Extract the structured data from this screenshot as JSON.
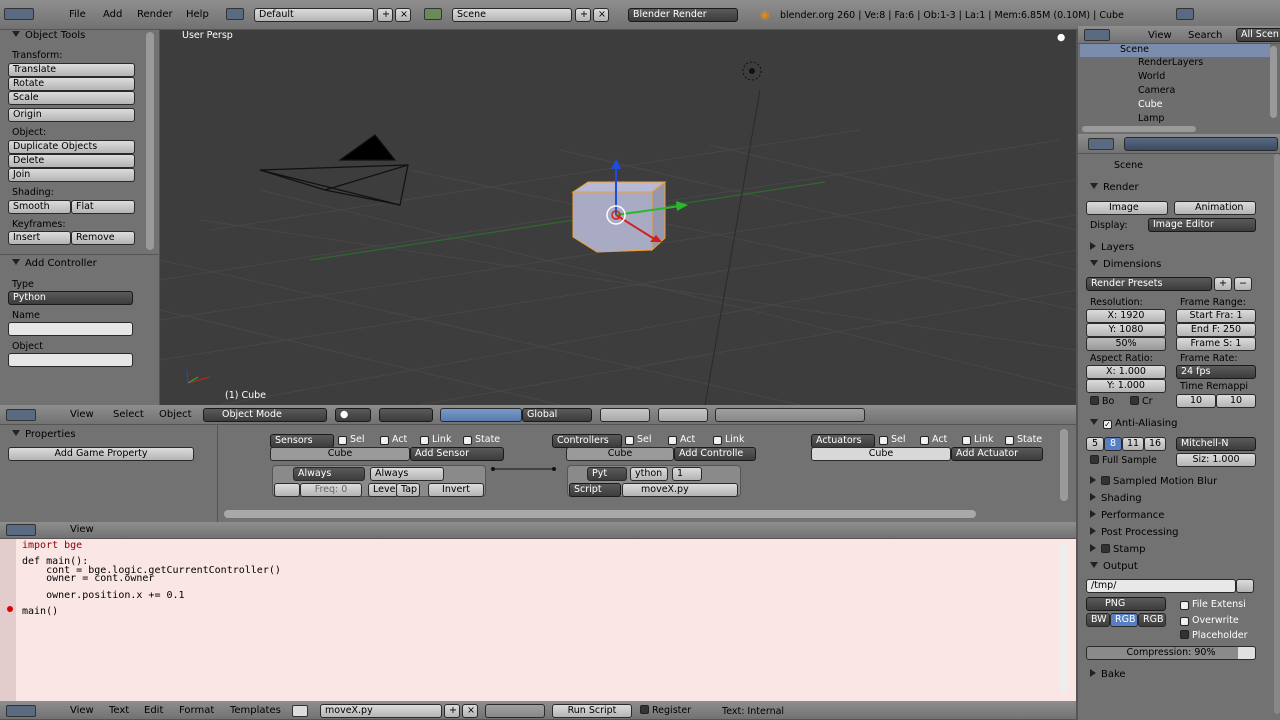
{
  "topbar": {
    "menus": [
      "File",
      "Add",
      "Render",
      "Help"
    ],
    "layout": "Default",
    "scene": "Scene",
    "engine": "Blender Render",
    "info": "blender.org 260 | Ve:8 | Fa:6 | Ob:1-3 | La:1 | Mem:6.85M (0.10M) | Cube"
  },
  "tools": {
    "title": "Object Tools",
    "transform": "Transform:",
    "translate": "Translate",
    "rotate": "Rotate",
    "scale": "Scale",
    "origin": "Origin",
    "object": "Object:",
    "duplicate": "Duplicate Objects",
    "delete": "Delete",
    "join": "Join",
    "shading": "Shading:",
    "smooth": "Smooth",
    "flat": "Flat",
    "keyframes": "Keyframes:",
    "insert": "Insert",
    "remove": "Remove"
  },
  "addcontroller": {
    "title": "Add Controller",
    "type_label": "Type",
    "type_value": "Python",
    "name_label": "Name",
    "object_label": "Object"
  },
  "viewport": {
    "title": "User Persp",
    "object": "(1) Cube"
  },
  "viewheader": {
    "view": "View",
    "select": "Select",
    "object": "Object",
    "mode": "Object Mode",
    "orient": "Global"
  },
  "outliner": {
    "view": "View",
    "search": "Search",
    "all": "All Scen",
    "items": [
      "Scene",
      "RenderLayers",
      "World",
      "Camera",
      "Cube",
      "Lamp"
    ]
  },
  "props": {
    "scene": "Scene",
    "render": "Render",
    "image": "Image",
    "animation": "Animation",
    "display_label": "Display:",
    "display": "Image Editor",
    "layers": "Layers",
    "dimensions": "Dimensions",
    "presets": "Render Presets",
    "resolution": "Resolution:",
    "framerange": "Frame Range:",
    "resx": "X: 1920",
    "resy": "Y: 1080",
    "pct": "50%",
    "start": "Start Fra: 1",
    "end": "End F: 250",
    "step": "Frame S: 1",
    "aspect": "Aspect Ratio:",
    "framerate": "Frame Rate:",
    "ax": "X: 1.000",
    "ay": "Y: 1.000",
    "fps": "24 fps",
    "remap": "Time Remappi",
    "r1": "10",
    "r2": "10",
    "bo": "Bo",
    "cr": "Cr",
    "aa": "Anti-Aliasing",
    "aa5": "5",
    "aa8": "8",
    "aa11": "11",
    "aa16": "16",
    "filter": "Mitchell-N",
    "fullsample": "Full Sample",
    "size": "Siz: 1.000",
    "smb": "Sampled Motion Blur",
    "shading": "Shading",
    "performance": "Performance",
    "post": "Post Processing",
    "stamp": "Stamp",
    "output": "Output",
    "path": "/tmp/",
    "png": "PNG",
    "fileext": "File Extensi",
    "bw": "BW",
    "rgb": "RGB",
    "rgba": "RGB",
    "overwrite": "Overwrite",
    "placeholder": "Placeholder",
    "compression": "Compression: 90%",
    "bake": "Bake"
  },
  "logic": {
    "properties": "Properties",
    "addprop": "Add Game Property",
    "sensors": "Sensors",
    "controllers": "Controllers",
    "actuators": "Actuators",
    "sel": "Sel",
    "act": "Act",
    "link": "Link",
    "state": "State",
    "cube": "Cube",
    "addsensor": "Add Sensor",
    "addcontroller": "Add Controlle",
    "addactuator": "Add Actuator",
    "always": "Always",
    "always2": "Always",
    "freq": "Freq: 0",
    "level": "Level",
    "tap": "Tap",
    "invert": "Invert",
    "pyt": "Pyt",
    "ython": "ython",
    "one": "1",
    "script": "Script",
    "file": "moveX.py"
  },
  "logicheader": {
    "view": "View",
    "select": "Select",
    "object": "Object"
  },
  "texthdr": {
    "view": "View"
  },
  "code": {
    "l1": "import bge",
    "l2": "",
    "l3": "def main():",
    "l4": "    cont = bge.logic.getCurrentController()",
    "l5": "    owner = cont.owner",
    "l6": "",
    "l7": "    owner.position.x += 0.1",
    "l8": "",
    "l9": "main()"
  },
  "bottombar": {
    "view": "View",
    "text": "Text",
    "edit": "Edit",
    "format": "Format",
    "templates": "Templates",
    "file": "moveX.py",
    "run": "Run Script",
    "register": "Register",
    "internal": "Text: Internal"
  }
}
